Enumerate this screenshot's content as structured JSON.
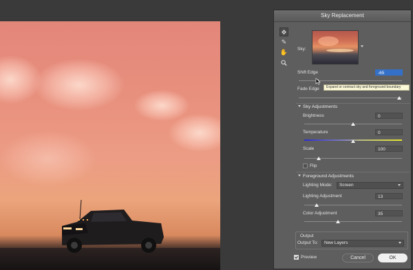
{
  "dialog": {
    "title": "Sky Replacement",
    "sky_label": "Sky:",
    "shift_edge": {
      "label": "Shift Edge",
      "value": "-65",
      "level": 0.0
    },
    "fade_edge": {
      "label": "Fade Edge"
    },
    "tooltip": "Expand or contract sky and foreground boundary",
    "sky_adjustments": {
      "title": "Sky Adjustments",
      "brightness": {
        "label": "Brightness",
        "value": "0"
      },
      "temperature": {
        "label": "Temperature",
        "value": "0"
      },
      "scale": {
        "label": "Scale",
        "value": "100"
      },
      "flip_label": "Flip"
    },
    "foreground_adjustments": {
      "title": "Foreground Adjustments",
      "lighting_mode_label": "Lighting Mode:",
      "lighting_mode_value": "Screen",
      "lighting_adjustment": {
        "label": "Lighting Adjustment",
        "value": "13"
      },
      "color_adjustment": {
        "label": "Color Adjustment",
        "value": "35"
      }
    },
    "output": {
      "title": "Output",
      "output_to_label": "Output To:",
      "output_to_value": "New Layers"
    },
    "preview_label": "Preview",
    "cancel_label": "Cancel",
    "ok_label": "OK"
  },
  "icons": [
    "move-icon",
    "sky-brush-icon",
    "hand-icon",
    "zoom-icon"
  ]
}
